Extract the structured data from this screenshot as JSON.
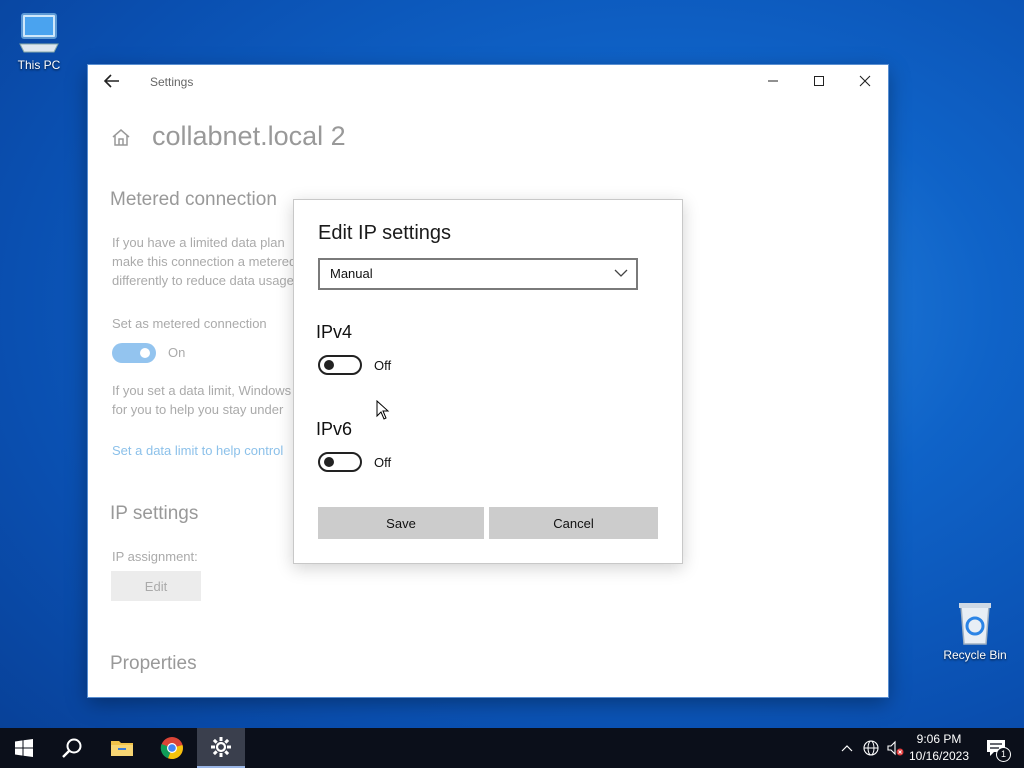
{
  "desktop": {
    "icons": [
      {
        "label": "This PC",
        "icon": "monitor-icon"
      },
      {
        "label": "Recycle Bin",
        "icon": "recycle-bin-icon"
      }
    ]
  },
  "window": {
    "title": "Settings",
    "page_title": "collabnet.local 2",
    "metered": {
      "heading": "Metered connection",
      "desc_lines": [
        "If you have a limited data plan",
        "make this connection a metered",
        "differently to reduce data usage"
      ],
      "toggle_label": "Set as metered connection",
      "toggle_state": "On",
      "limit_lines": [
        "If you set a data limit, Windows",
        "for you to help you stay under"
      ],
      "link": "Set a data limit to help control"
    },
    "ip": {
      "heading": "IP settings",
      "assignment_label": "IP assignment:",
      "edit_label": "Edit"
    },
    "properties_heading": "Properties"
  },
  "dialog": {
    "title": "Edit IP settings",
    "mode": "Manual",
    "ipv4": {
      "label": "IPv4",
      "state": "Off"
    },
    "ipv6": {
      "label": "IPv6",
      "state": "Off"
    },
    "save_label": "Save",
    "cancel_label": "Cancel"
  },
  "taskbar": {
    "apps": [
      "start-icon",
      "search-icon",
      "file-explorer-icon",
      "chrome-icon",
      "settings-icon"
    ],
    "time": "9:06 PM",
    "date": "10/16/2023",
    "notification_count": "1"
  },
  "colors": {
    "accent": "#0078d7",
    "toggle_on": "#93c4ef"
  }
}
